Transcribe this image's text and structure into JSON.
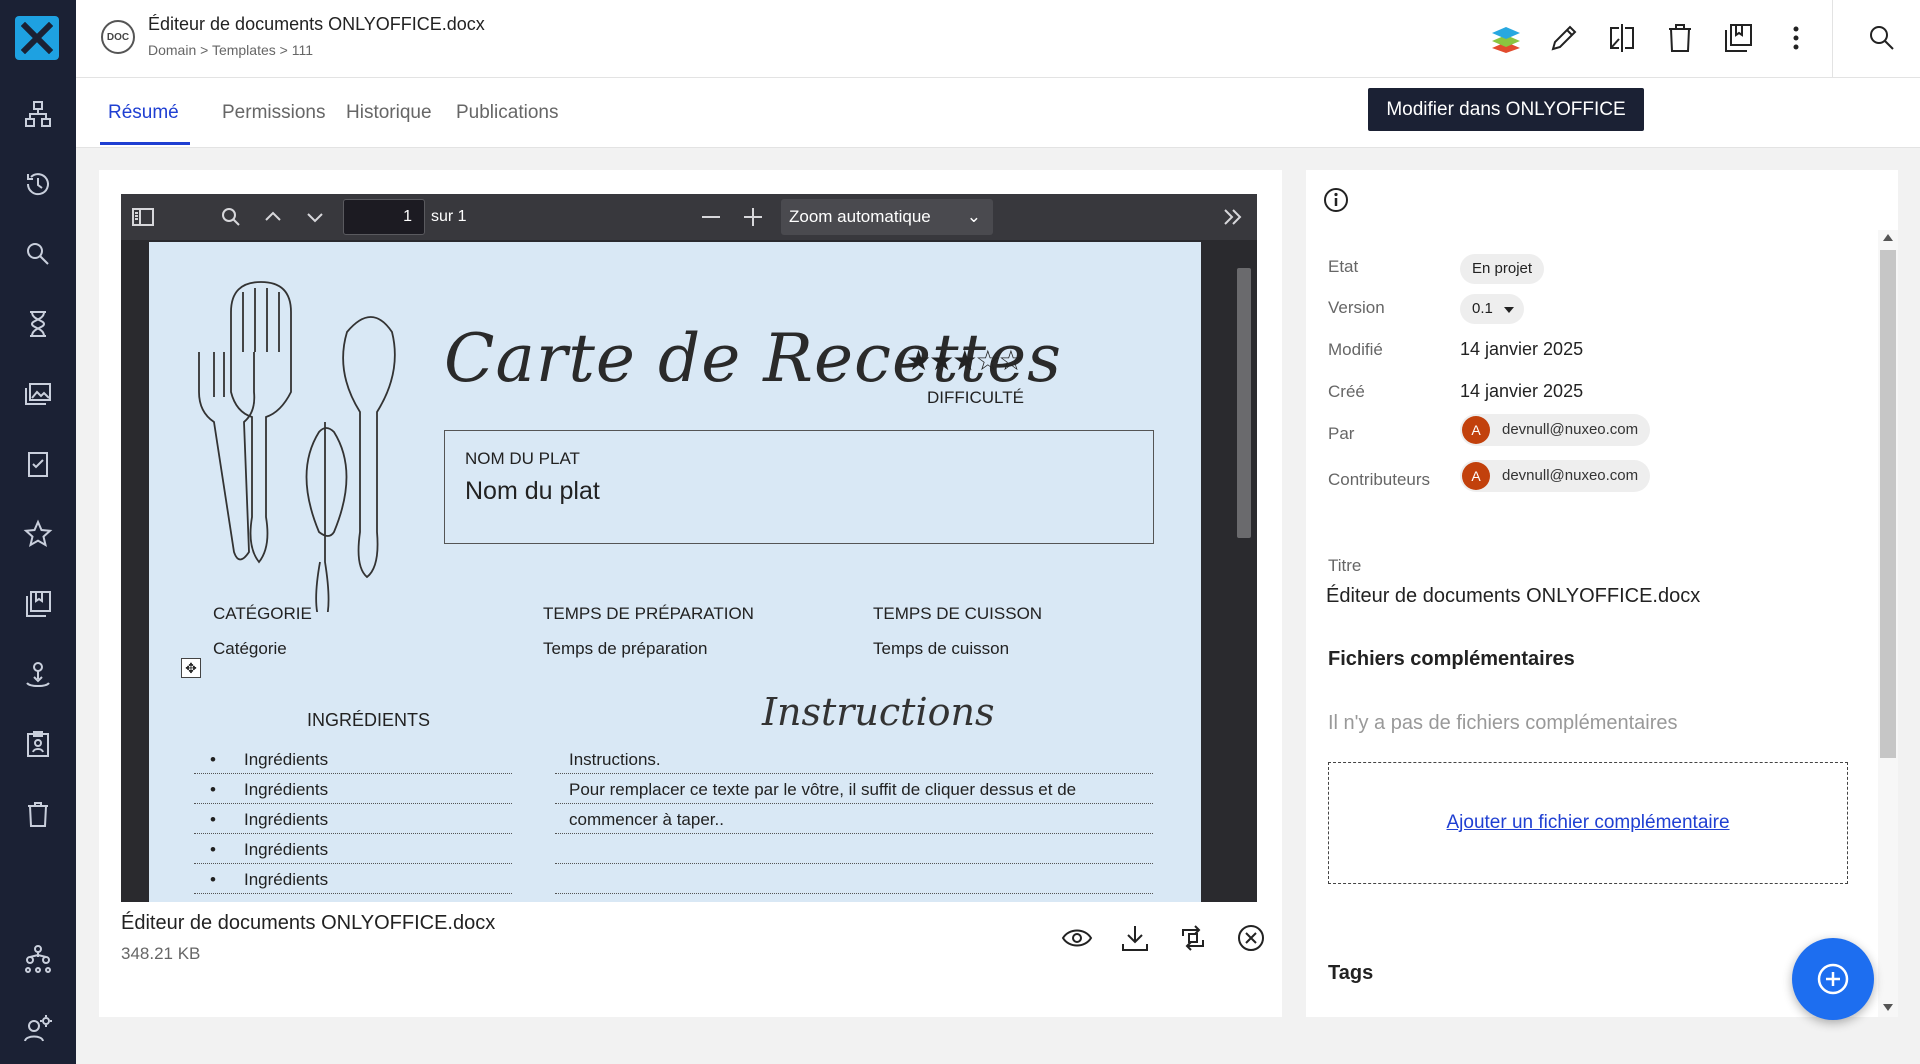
{
  "header": {
    "doc_badge": "DOC",
    "title": "Éditeur de documents ONLYOFFICE.docx",
    "breadcrumb": "Domain > Templates > 111",
    "actions": [
      "onlyoffice-icon",
      "pencil-icon",
      "compare-icon",
      "trash-icon",
      "collections-icon",
      "more-vert-icon"
    ],
    "search_icon": "search-icon"
  },
  "leftnav": {
    "items": [
      "sitemap-icon",
      "history-icon",
      "search-icon",
      "hourglass-icon",
      "gallery-icon",
      "tasks-icon",
      "star-icon",
      "collections-icon",
      "person-upload-icon",
      "clipboard-user-icon",
      "trash-icon"
    ],
    "bottom_items": [
      "admin-tree-icon",
      "user-settings-icon"
    ]
  },
  "tabs": {
    "items": [
      {
        "label": "Résumé",
        "active": true
      },
      {
        "label": "Permissions",
        "active": false
      },
      {
        "label": "Historique",
        "active": false
      },
      {
        "label": "Publications",
        "active": false
      }
    ],
    "tooltip": "Modifier dans ONLYOFFICE"
  },
  "viewer": {
    "page_number": "1",
    "page_total": "sur 1",
    "zoom": "Zoom automatique",
    "document": {
      "title": "Carte de Recettes",
      "stars": "★★★☆☆",
      "difficulty": "DIFFICULTÉ",
      "dish_label": "NOM DU PLAT",
      "dish_value": "Nom du plat",
      "category_label": "CATÉGORIE",
      "category_value": "Catégorie",
      "prep_label": "TEMPS DE PRÉPARATION",
      "prep_value": "Temps de préparation",
      "cook_label": "TEMPS DE CUISSON",
      "cook_value": "Temps de cuisson",
      "ingredients_header": "INGRÉDIENTS",
      "instructions_header": "Instructions",
      "ingredients": [
        "Ingrédients",
        "Ingrédients",
        "Ingrédients",
        "Ingrédients",
        "Ingrédients"
      ],
      "instructions": [
        "Instructions.",
        "Pour remplacer ce texte par le vôtre, il suffit de cliquer dessus et de",
        "commencer à taper..",
        "",
        ""
      ]
    }
  },
  "file": {
    "name": "Éditeur de documents ONLYOFFICE.docx",
    "size": "348.21 KB",
    "actions": [
      "eye-icon",
      "download-icon",
      "replace-icon",
      "remove-circle-icon"
    ]
  },
  "metadata": {
    "state_label": "Etat",
    "state_value": "En projet",
    "version_label": "Version",
    "version_value": "0.1",
    "modified_label": "Modifié",
    "modified_value": "14 janvier 2025",
    "created_label": "Créé",
    "created_value": "14 janvier 2025",
    "by_label": "Par",
    "by_avatar": "A",
    "by_value": "devnull@nuxeo.com",
    "contrib_label": "Contributeurs",
    "contrib_avatar": "A",
    "contrib_value": "devnull@nuxeo.com",
    "title_label": "Titre",
    "title_value": "Éditeur de documents ONLYOFFICE.docx",
    "attachments_title": "Fichiers complémentaires",
    "attachments_empty": "Il n'y a pas de fichiers complémentaires",
    "attachments_add": "Ajouter un fichier complémentaire",
    "tags_title": "Tags"
  },
  "colors": {
    "nav_bg": "#1b2134",
    "accent": "#1f3fd2",
    "fab": "#1d6ef0",
    "logo": "#1ea1e1",
    "page_bg": "#d9e8f5",
    "avatar": "#c2410c"
  }
}
